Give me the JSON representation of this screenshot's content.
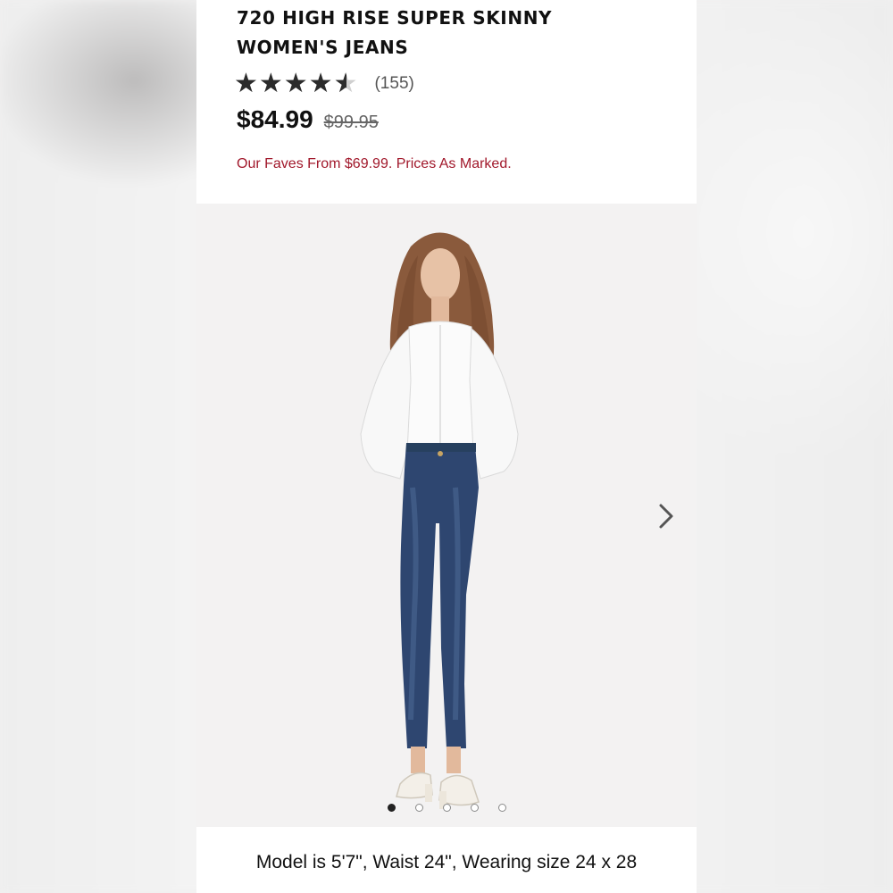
{
  "product": {
    "title_line1": "720 HIGH RISE SUPER SKINNY",
    "title_line2": "WOMEN'S JEANS",
    "rating": 4.5,
    "rating_max": 5,
    "review_count": "(155)",
    "sale_price": "$84.99",
    "original_price": "$99.95",
    "promo_text": "Our Faves From $69.99. Prices As Marked."
  },
  "gallery": {
    "image_icon": "model-photo",
    "next_icon": "chevron-right-icon",
    "total_slides": 5,
    "active_slide": 1
  },
  "caption": {
    "text": "Model is 5'7\", Waist 24\", Wearing size 24 x 28"
  },
  "colors": {
    "promo": "#a1182b",
    "star_filled": "#2b2b2b",
    "star_empty": "#cfcfcf",
    "jeans": "#2e4670",
    "shirt": "#fbfbfb"
  }
}
